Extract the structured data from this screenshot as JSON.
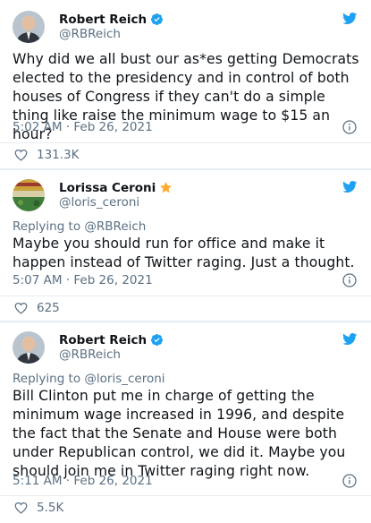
{
  "tweets": [
    {
      "name": "Robert Reich",
      "handle": "@RBReich",
      "verified": true,
      "text": "Why did we all bust our as*es getting Democrats elected to the presidency and in control of both houses of Congress if they can't do a simple thing like raise the minimum wage to $15 an hour?",
      "time": "5:02 AM · Feb 26, 2021",
      "likes": "131.3K"
    },
    {
      "name": "Lorissa Ceroni",
      "name_emoji": "star",
      "handle": "@loris_ceroni",
      "replying_to": "Replying to @RBReich",
      "text": "Maybe you should run for office and make it happen instead of Twitter raging. Just a thought.",
      "time": "5:07 AM · Feb 26, 2021",
      "likes": "625"
    },
    {
      "name": "Robert Reich",
      "handle": "@RBReich",
      "verified": true,
      "replying_to": "Replying to @loris_ceroni",
      "text": "Bill Clinton put me in charge of getting the minimum wage increased in 1996, and despite the fact that the Senate and House were both under Republican control, we did it. Maybe you should join me in Twitter raging right now.",
      "time": "5:11 AM · Feb 26, 2021",
      "likes": "5.5K"
    }
  ],
  "icons": {
    "brand": "twitter-bird-icon",
    "verified": "verified-badge-icon",
    "info": "info-icon",
    "like": "heart-icon"
  },
  "colors": {
    "twitter_blue": "#1da1f2",
    "secondary_text": "#5b7083",
    "star": "#ffac33"
  }
}
